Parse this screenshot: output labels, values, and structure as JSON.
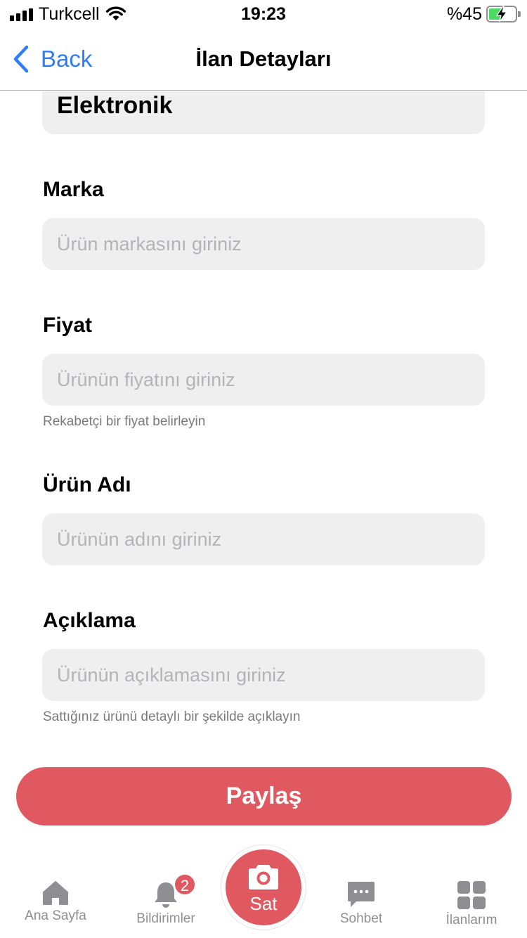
{
  "status_bar": {
    "carrier": "Turkcell",
    "time": "19:23",
    "battery_percent": "%45",
    "battery_level": 0.45
  },
  "nav": {
    "back_label": "Back",
    "title": "İlan Detayları"
  },
  "form": {
    "category_value": "Elektronik",
    "brand": {
      "label": "Marka",
      "placeholder": "Ürün markasını giriniz"
    },
    "price": {
      "label": "Fiyat",
      "placeholder": "Ürünün fiyatını giriniz",
      "hint": "Rekabetçi bir fiyat belirleyin"
    },
    "product_name": {
      "label": "Ürün Adı",
      "placeholder": "Ürünün adını giriniz"
    },
    "description": {
      "label": "Açıklama",
      "placeholder": "Ürünün açıklamasını giriniz",
      "hint": "Sattığınız ürünü detaylı bir şekilde açıklayın"
    },
    "share_button": "Paylaş"
  },
  "tabbar": {
    "items": [
      {
        "label": "Ana Sayfa",
        "icon": "home-icon"
      },
      {
        "label": "Bildirimler",
        "icon": "bell-icon",
        "badge": "2"
      },
      {
        "label": "Sat",
        "icon": "camera-icon"
      },
      {
        "label": "Sohbet",
        "icon": "chat-icon"
      },
      {
        "label": "İlanlarım",
        "icon": "grid-icon"
      }
    ]
  },
  "colors": {
    "accent": "#e05961",
    "link": "#2f7cf6",
    "field_bg": "#efefef",
    "inactive_tab": "#8e8e93"
  }
}
